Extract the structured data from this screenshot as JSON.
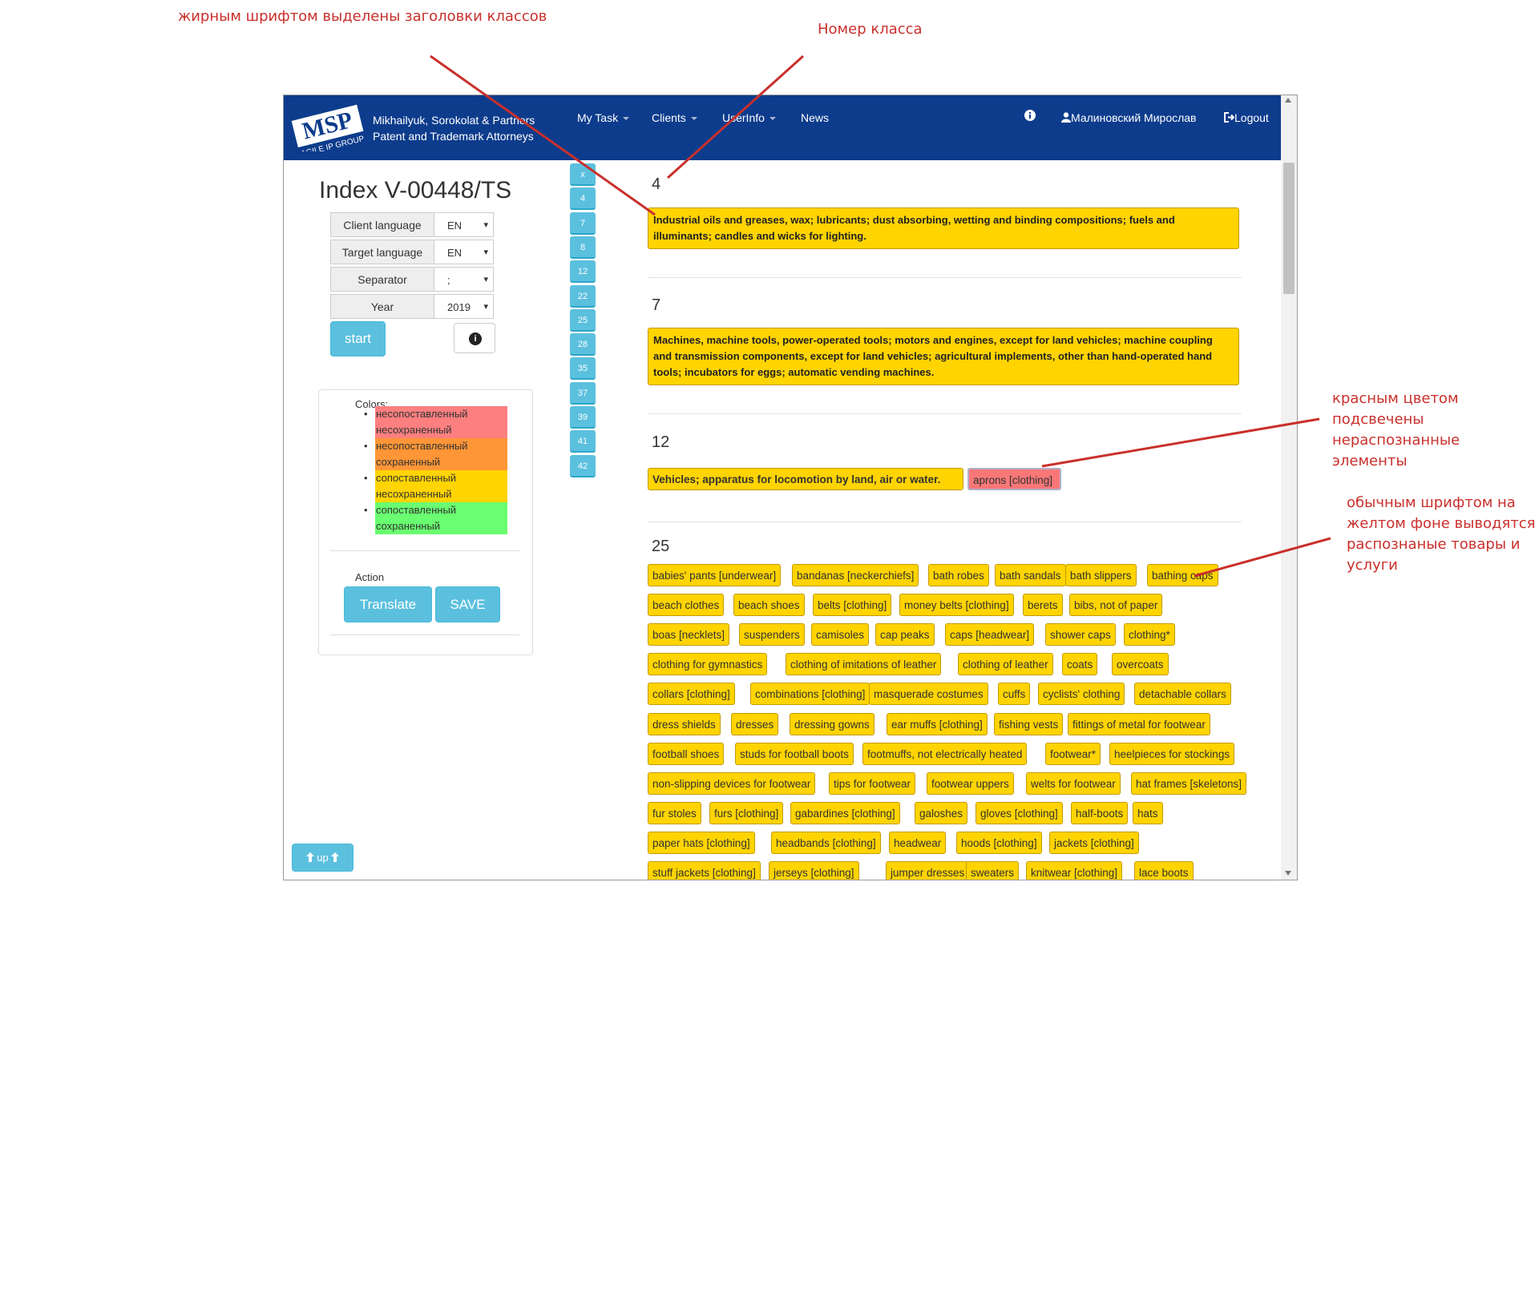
{
  "annotations": {
    "bold_headers": "жирным шрифтом выделены заголовки классов",
    "class_number": "Номер класса",
    "red_unrecognized": "красным цветом подсвечены нераспознанные элементы",
    "yellow_recognized": "обычным шрифтом на желтом фоне выводятся распознаные товары и услуги"
  },
  "navbar": {
    "logo_text": "MSP",
    "logo_subtext": "AGILE IP GROUP",
    "brand_line1": "Mikhailyuk, Sorokolat & Partners",
    "brand_line2": "Patent and Trademark Attorneys",
    "menu": {
      "my_task": "My Task",
      "clients": "Clients",
      "userinfo": "UserInfo",
      "news": "News"
    },
    "user_name": "Малиновский Мирослав",
    "logout": "Logout"
  },
  "left": {
    "index_title": "Index V-00448/TS",
    "fields": {
      "client_language": {
        "label": "Client language",
        "value": "EN"
      },
      "target_language": {
        "label": "Target language",
        "value": "EN"
      },
      "separator": {
        "label": "Separator",
        "value": ";"
      },
      "year": {
        "label": "Year",
        "value": "2019"
      }
    },
    "start_label": "start",
    "colors_label": "Colors:",
    "legend": [
      {
        "line1": "несопоставленный",
        "line2": "несохраненный",
        "color": "#fe7f7f"
      },
      {
        "line1": "несопоставленный",
        "line2": "сохраненный",
        "color": "#fe9537"
      },
      {
        "line1": "сопоставленный",
        "line2": "несохраненный",
        "color": "#ffd400"
      },
      {
        "line1": "сопоставленный",
        "line2": "сохраненный",
        "color": "#6afe71"
      }
    ],
    "action_label": "Action",
    "translate_label": "Translate",
    "save_label": "SAVE",
    "up_label": "up"
  },
  "class_nav": [
    "x",
    "4",
    "7",
    "8",
    "12",
    "22",
    "25",
    "28",
    "35",
    "37",
    "39",
    "41",
    "42"
  ],
  "classes": {
    "c4": {
      "num": "4",
      "header": "Industrial oils and greases, wax; lubricants; dust absorbing, wetting and binding compositions; fuels and illuminants; candles and wicks for lighting."
    },
    "c7": {
      "num": "7",
      "header": "Machines, machine tools, power-operated tools; motors and engines, except for land vehicles; machine coupling and transmission components, except for land vehicles; agricultural implements, other than hand-operated hand tools; incubators for eggs; automatic vending machines."
    },
    "c12": {
      "num": "12",
      "header": "Vehicles; apparatus for locomotion by land, air or water.",
      "unrecognized": "aprons [clothing]"
    },
    "c25": {
      "num": "25",
      "items": [
        "babies' pants [underwear]",
        "bandanas [neckerchiefs]",
        "bath robes",
        "bath sandals",
        "bath slippers",
        "bathing caps",
        "beach clothes",
        "beach shoes",
        "belts [clothing]",
        "money belts [clothing]",
        "berets",
        "bibs, not of paper",
        "boas [necklets]",
        "suspenders",
        "camisoles",
        "cap peaks",
        "caps [headwear]",
        "shower caps",
        "clothing*",
        "clothing for gymnastics",
        "clothing of imitations of leather",
        "clothing of leather",
        "coats",
        "overcoats",
        "collars [clothing]",
        "combinations [clothing]",
        "masquerade costumes",
        "cuffs",
        "cyclists' clothing",
        "detachable collars",
        "dress shields",
        "dresses",
        "dressing gowns",
        "ear muffs [clothing]",
        "fishing vests",
        "fittings of metal for footwear",
        "football shoes",
        "studs for football boots",
        "footmuffs, not electrically heated",
        "footwear*",
        "heelpieces for stockings",
        "non-slipping devices for footwear",
        "tips for footwear",
        "footwear uppers",
        "welts for footwear",
        "hat frames [skeletons]",
        "fur stoles",
        "furs [clothing]",
        "gabardines [clothing]",
        "galoshes",
        "gloves [clothing]",
        "half-boots",
        "hats",
        "paper hats [clothing]",
        "headbands [clothing]",
        "headwear",
        "hoods [clothing]",
        "jackets [clothing]",
        "stuff jackets [clothing]",
        "jerseys [clothing]",
        "jumper dresses",
        "sweaters",
        "knitwear [clothing]",
        "lace boots"
      ]
    }
  }
}
